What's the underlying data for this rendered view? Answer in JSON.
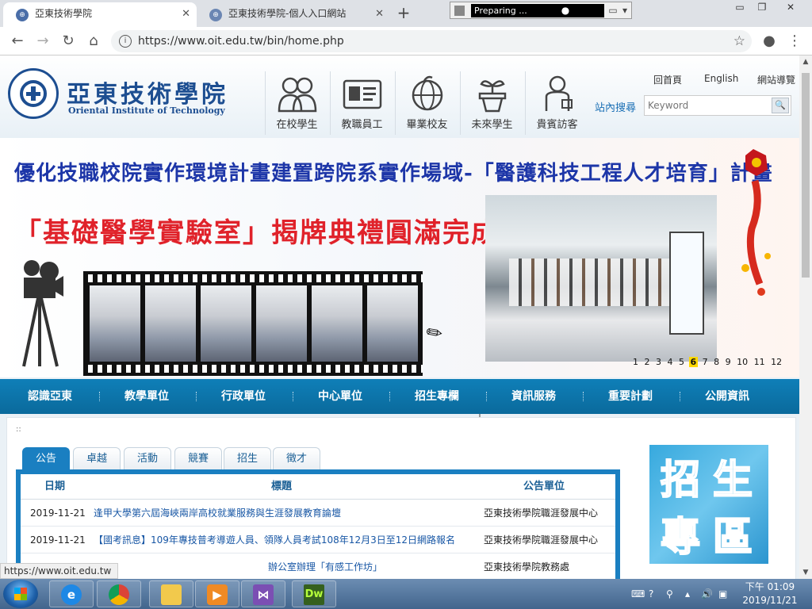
{
  "browser": {
    "tabs": [
      {
        "title": "亞東技術學院"
      },
      {
        "title": "亞東技術學院-個人入口網站"
      }
    ],
    "recorder_status": "Preparing ...",
    "url": "https://www.oit.edu.tw/bin/home.php",
    "status_url": "https://www.oit.edu.tw"
  },
  "site": {
    "name_cn": "亞東技術學院",
    "name_en": "Oriental Institute of Technology",
    "roles": [
      "在校學生",
      "教職員工",
      "畢業校友",
      "未來學生",
      "貴賓訪客"
    ],
    "links": {
      "home": "回首頁",
      "english": "English",
      "sitemap": "網站導覽"
    },
    "search_label": "站內搜尋",
    "search_placeholder": "Keyword"
  },
  "banner": {
    "line1": "優化技職校院實作環境計畫建置跨院系實作場域-「醫護科技工程人才培育」計畫",
    "line2": "「基礎醫學實驗室」揭牌典禮圓滿完成！",
    "pages": [
      "1",
      "2",
      "3",
      "4",
      "5",
      "6",
      "7",
      "8",
      "9",
      "10",
      "11",
      "12"
    ],
    "active_page": "6"
  },
  "mainnav": [
    "認識亞東",
    "教學單位",
    "行政單位",
    "中心單位",
    "招生專欄",
    "資訊服務",
    "重要計劃",
    "公開資訊"
  ],
  "content": {
    "dots": "::",
    "tabs": [
      "公告",
      "卓越",
      "活動",
      "競賽",
      "招生",
      "徵才"
    ],
    "columns": {
      "date": "日期",
      "title": "標題",
      "unit": "公告單位"
    },
    "rows": [
      {
        "date": "2019-11-21",
        "title": "逢甲大學第六屆海峽兩岸高校就業服務與生涯發展教育論壇",
        "unit": "亞東技術學院職涯發展中心"
      },
      {
        "date": "2019-11-21",
        "title": "【國考訊息】109年專技普考導遊人員、領隊人員考試108年12月3日至12日網路報名",
        "unit": "亞東技術學院職涯發展中心"
      },
      {
        "date": "",
        "title": "辦公室辦理「有感工作坊」",
        "unit": "亞東技術學院教務處"
      }
    ],
    "admission_chars": [
      "招",
      "生",
      "專",
      "區"
    ]
  },
  "taskbar": {
    "apps": [
      "e",
      "",
      "",
      "",
      "",
      "Dw"
    ],
    "clock_time": "下午 01:09",
    "clock_date": "2019/11/21"
  },
  "colors": {
    "brand": "#1d4e91",
    "nav": "#0f7fb8",
    "banner_red": "#e0222a",
    "banner_blue": "#1d36a8"
  }
}
